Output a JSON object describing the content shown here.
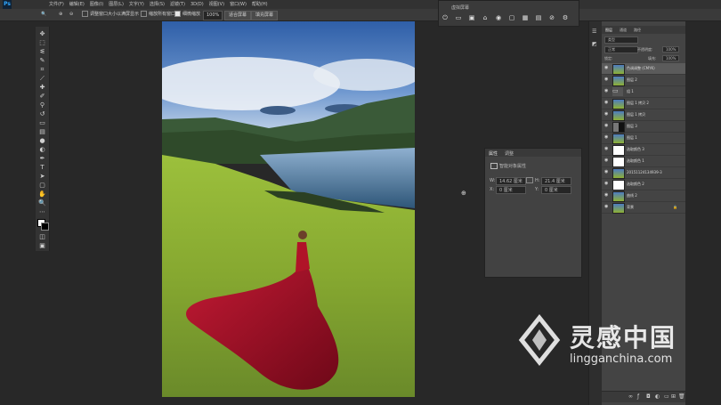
{
  "menubar": {
    "app_logo": "Ps",
    "menus": [
      "文件(F)",
      "编辑(E)",
      "图像(I)",
      "图层(L)",
      "文字(Y)",
      "选择(S)",
      "滤镜(T)",
      "3D(D)",
      "视图(V)",
      "窗口(W)",
      "帮助(H)"
    ]
  },
  "options": {
    "checkbox1_label": "调整窗口大小以满屏显示",
    "checkbox2_label": "缩放所有窗口",
    "checkbox3_label": "细微缩放",
    "zoom_value": "100%",
    "fit_screen": "适合屏幕",
    "fill_screen": "填充屏幕"
  },
  "floatbar": {
    "title": "虚拟屏幕"
  },
  "properties": {
    "tab1": "属性",
    "tab2": "调整",
    "section_title": "智能对象属性",
    "w_label": "W:",
    "w_value": "14.62 厘米",
    "h_label": "H:",
    "h_value": "21.4 厘米",
    "x_label": "X:",
    "x_value": "0 厘米",
    "y_label": "Y:",
    "y_value": "0 厘米"
  },
  "layers": {
    "tab_layers": "图层",
    "tab_channels": "通道",
    "tab_paths": "路径",
    "kind": "类型",
    "blend_mode": "正常",
    "opacity_label": "不透明度:",
    "opacity_value": "100%",
    "lock_label": "锁定:",
    "fill_label": "填充:",
    "fill_value": "100%",
    "rows": [
      {
        "name": "色调调整 (CMYK)",
        "active": true,
        "thumb": "photo"
      },
      {
        "name": "图层 2",
        "thumb": "photo"
      },
      {
        "name": "组 1",
        "thumb": "folder"
      },
      {
        "name": "图层 1 拷贝 2",
        "thumb": "photo"
      },
      {
        "name": "图层 1 拷贝",
        "thumb": "photo"
      },
      {
        "name": "图层 3",
        "thumb": "mask"
      },
      {
        "name": "图层 1",
        "thumb": "photo"
      },
      {
        "name": "选取颜色 3",
        "thumb": "adj"
      },
      {
        "name": "选取颜色 1",
        "thumb": "adj"
      },
      {
        "name": "20151124134939-3",
        "thumb": "photo"
      },
      {
        "name": "选取颜色 2",
        "thumb": "adj"
      },
      {
        "name": "曲线 2",
        "thumb": "adj"
      },
      {
        "name": "背景",
        "thumb": "photo"
      }
    ]
  },
  "watermark": {
    "brand": "灵感中国",
    "url": "lingganchina.com"
  },
  "colors": {
    "ps_blue": "#31a8ff",
    "dress_red": "#a3122a",
    "grass": "#8fb134",
    "sky": "#3d6fb5"
  }
}
